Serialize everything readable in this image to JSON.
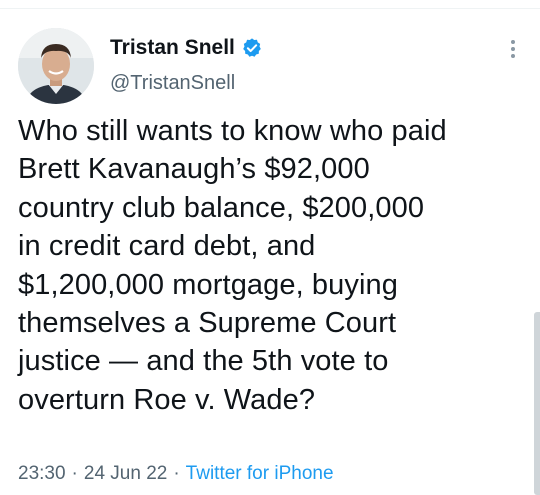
{
  "author": {
    "display_name": "Tristan Snell",
    "handle": "@TristanSnell",
    "verified": true,
    "avatar_icon": "profile-photo-icon"
  },
  "tweet": {
    "lines": [
      "Who still wants to know who paid",
      "Brett Kavanaugh’s $92,000",
      "country club balance, $200,000",
      "in credit card debt, and",
      "$1,200,000 mortgage, buying",
      "themselves a Supreme Court",
      "justice — and the 5th vote to",
      "overturn Roe v. Wade?"
    ]
  },
  "meta": {
    "time": "23:30",
    "separator": "·",
    "date": "24 Jun 22",
    "source": "Twitter for iPhone"
  },
  "colors": {
    "text": "#0f1419",
    "secondary": "#536471",
    "accent": "#1d9bf0"
  }
}
